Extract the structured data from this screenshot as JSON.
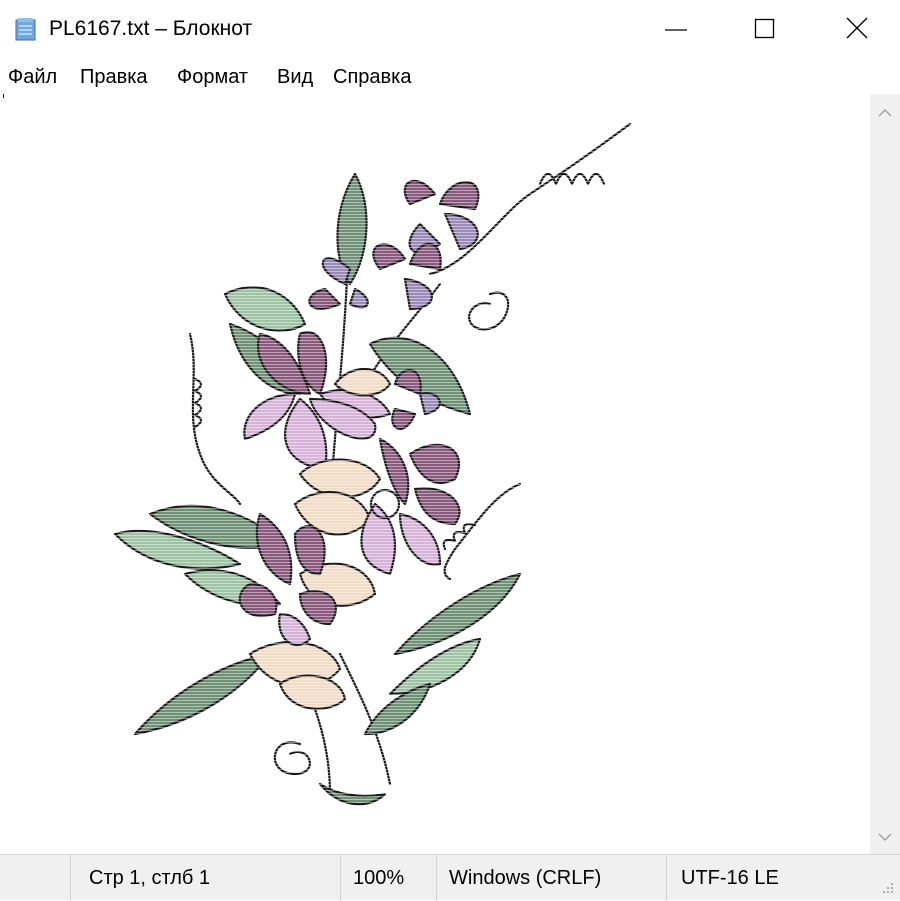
{
  "window": {
    "title": "PL6167.txt – Блокнот"
  },
  "menu": [
    "Файл",
    "Правка",
    "Формат",
    "Вид",
    "Справка"
  ],
  "status": {
    "position": "Стр 1, стлб 1",
    "zoom": "100%",
    "line_endings": "Windows (CRLF)",
    "encoding": "UTF-16 LE"
  },
  "colors": {
    "lavender": "#d7b3d9",
    "mauve": "#8a5a7e",
    "peach": "#f2dcc6",
    "leaf_green": "#6f9276",
    "light_leaf": "#9dc3a3",
    "violet": "#9a8ab8",
    "outline": "#1b1b1b"
  }
}
